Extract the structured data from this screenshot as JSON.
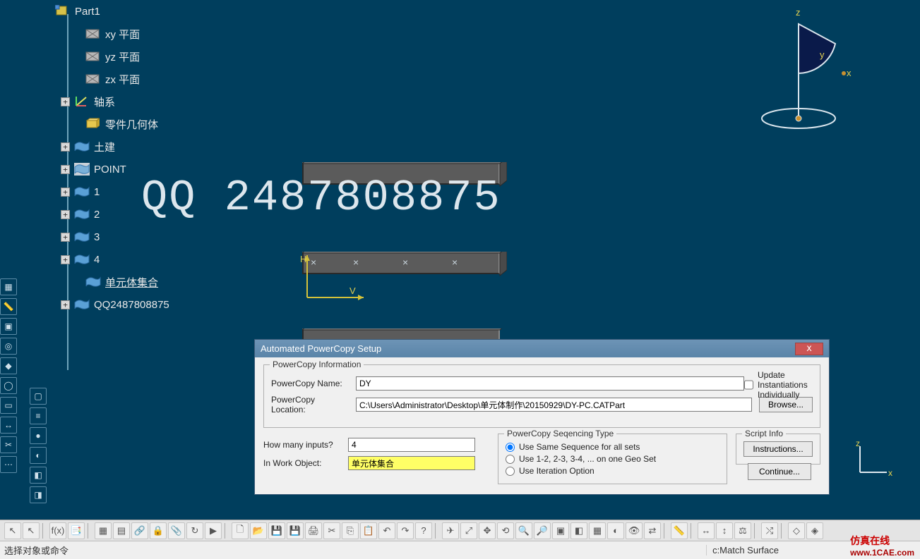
{
  "tree": {
    "root": "Part1",
    "items": [
      {
        "label": "xy 平面",
        "icon": "plane",
        "expand": null
      },
      {
        "label": "yz 平面",
        "icon": "plane",
        "expand": null
      },
      {
        "label": "zx 平面",
        "icon": "plane",
        "expand": null
      },
      {
        "label": "轴系",
        "icon": "axis",
        "expand": "+"
      },
      {
        "label": "零件几何体",
        "icon": "body",
        "expand": null
      },
      {
        "label": "土建",
        "icon": "geoset",
        "expand": "+"
      },
      {
        "label": "POINT",
        "icon": "geoset-hl",
        "expand": "+"
      },
      {
        "label": "1",
        "icon": "geoset",
        "expand": "+"
      },
      {
        "label": "2",
        "icon": "geoset",
        "expand": "+"
      },
      {
        "label": "3",
        "icon": "geoset",
        "expand": "+"
      },
      {
        "label": "4",
        "icon": "geoset",
        "expand": "+"
      },
      {
        "label": "单元体集合",
        "icon": "geoset",
        "expand": null,
        "underline": true
      },
      {
        "label": "QQ2487808875",
        "icon": "geoset",
        "expand": "+"
      }
    ]
  },
  "dialog": {
    "title": "Automated PowerCopy Setup",
    "close": "x",
    "info_group": "PowerCopy Information",
    "name_label": "PowerCopy Name:",
    "name_value": "DY",
    "loc_label": "PowerCopy Location:",
    "loc_value": "C:\\Users\\Administrator\\Desktop\\单元体制作\\20150929\\DY-PC.CATPart",
    "browse": "Browse...",
    "inputs_label": "How many inputs?",
    "inputs_value": "4",
    "iwo_label": "In Work Object:",
    "iwo_value": "单元体集合",
    "seq_group": "PowerCopy Seqencing Type",
    "seq_opt1": "Use Same Sequence for all sets",
    "seq_opt2": "Use 1-2, 2-3, 3-4, ... on one Geo Set",
    "seq_opt3": "Use Iteration Option",
    "script_group": "Script Info",
    "instructions": "Instructions...",
    "update_label": "Update Instantiations Individually",
    "continue": "Continue..."
  },
  "status": {
    "left": "选择对象或命令",
    "right": "c:Match Surface"
  },
  "compass": {
    "x": "x",
    "y": "y",
    "z": "z"
  },
  "hv": {
    "h": "H",
    "v": "V"
  },
  "mini_axis": {
    "x": "x",
    "z": "z"
  },
  "watermark_text": "QQ 2487808875",
  "brand": {
    "cn": "仿真在线",
    "url": "www.1CAE.com"
  }
}
